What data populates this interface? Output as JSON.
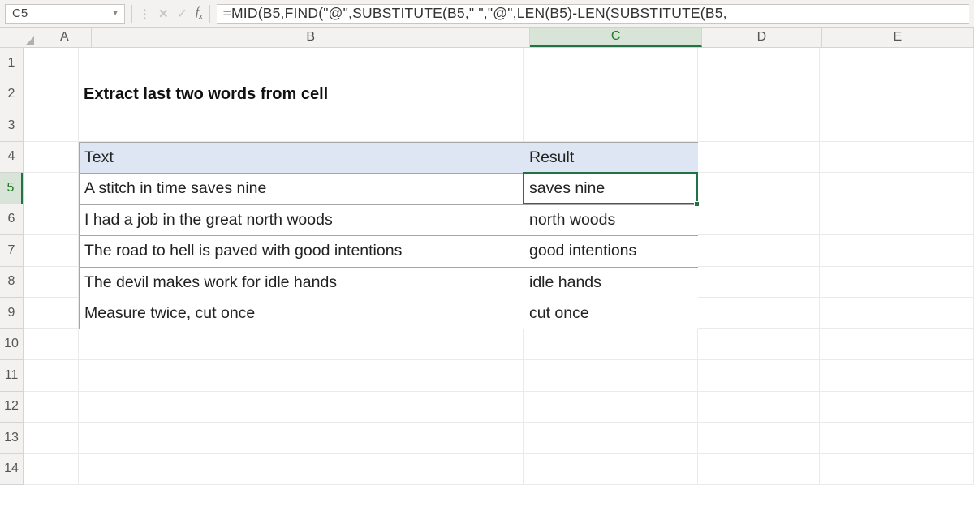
{
  "formula_bar": {
    "active_cell_ref": "C5",
    "formula": "=MID(B5,FIND(\"@\",SUBSTITUTE(B5,\" \",\"@\",LEN(B5)-LEN(SUBSTITUTE(B5,"
  },
  "columns": [
    "A",
    "B",
    "C",
    "D",
    "E"
  ],
  "row_labels": [
    "1",
    "2",
    "3",
    "4",
    "5",
    "6",
    "7",
    "8",
    "9",
    "10",
    "11",
    "12",
    "13",
    "14"
  ],
  "title": "Extract last two words from cell",
  "table": {
    "headers": {
      "text": "Text",
      "result": "Result"
    },
    "rows": [
      {
        "text": "A stitch in time saves nine",
        "result": "saves nine"
      },
      {
        "text": "I had a job in the great north woods",
        "result": "north woods"
      },
      {
        "text": "The road to hell is paved with good intentions",
        "result": "good intentions"
      },
      {
        "text": "The devil makes work for idle hands",
        "result": "idle hands"
      },
      {
        "text": "Measure twice, cut once",
        "result": "cut once"
      }
    ]
  },
  "active": {
    "row": 5,
    "col": "C"
  },
  "chart_data": {
    "type": "table",
    "title": "Extract last two words from cell",
    "columns": [
      "Text",
      "Result"
    ],
    "rows": [
      [
        "A stitch in time saves nine",
        "saves nine"
      ],
      [
        "I had a job in the great north woods",
        "north woods"
      ],
      [
        "The road to hell is paved with good intentions",
        "good intentions"
      ],
      [
        "The devil makes work for idle hands",
        "idle hands"
      ],
      [
        "Measure twice, cut once",
        "cut once"
      ]
    ]
  }
}
